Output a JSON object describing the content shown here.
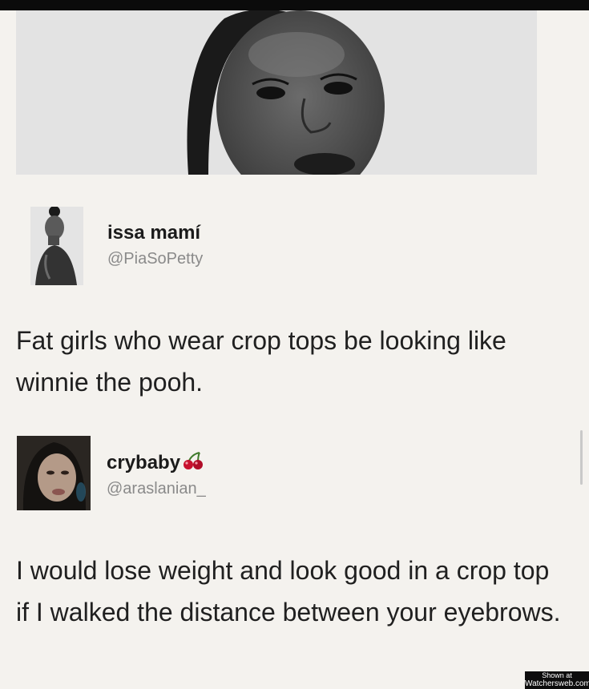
{
  "header_image": {
    "icon": "portrait-photo"
  },
  "tweet1": {
    "author": {
      "name": "issa mamí",
      "handle": "@PiaSoPetty",
      "avatar_icon": "profile-avatar"
    },
    "text": "Fat girls who wear crop tops be looking like winnie the pooh."
  },
  "tweet2": {
    "author": {
      "name": "crybaby",
      "name_emoji_icon": "cherry-emoji",
      "handle": "@araslanian_",
      "avatar_icon": "profile-avatar"
    },
    "text": "I would lose weight and look good in a crop top if I walked the distance between your eyebrows."
  },
  "watermark": {
    "line1": "Shown at",
    "line2": "Watchersweb.com"
  },
  "colors": {
    "background": "#f4f2ee",
    "text": "#202020",
    "handle": "#8a8a8a",
    "cherry_red": "#c8102e",
    "watermark_bg": "#0d0d0d"
  }
}
